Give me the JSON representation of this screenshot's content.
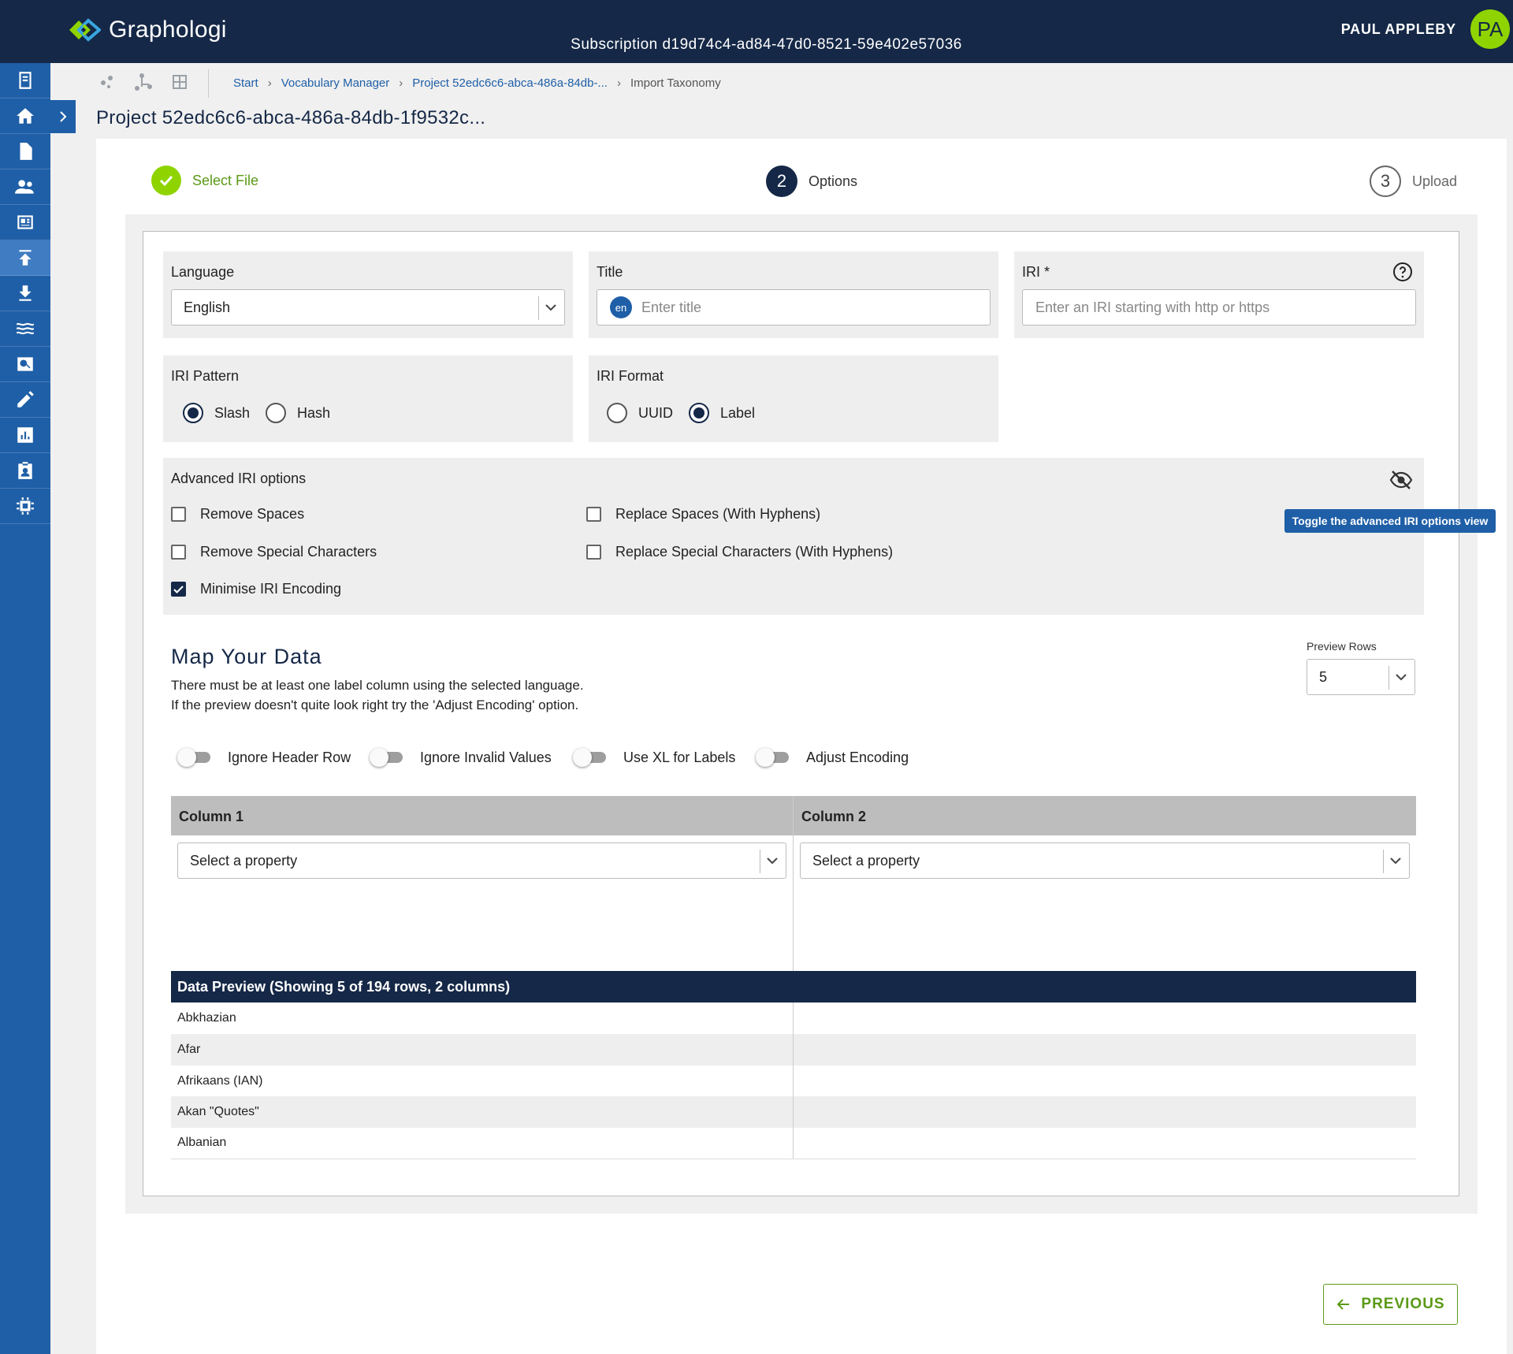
{
  "header": {
    "app_name": "Graphologi",
    "subscription": "Subscription d19d74c4-ad84-47d0-8521-59e402e57036",
    "user_name": "PAUL APPLEBY",
    "user_initials": "PA",
    "brand_color": "#152847",
    "accent_color": "#8fd400"
  },
  "sidebar": {
    "items": [
      {
        "icon": "notebook-icon"
      },
      {
        "icon": "home-icon"
      },
      {
        "icon": "document-icon"
      },
      {
        "icon": "users-icon"
      },
      {
        "icon": "article-icon"
      },
      {
        "icon": "upload-icon",
        "active": true
      },
      {
        "icon": "download-icon"
      },
      {
        "icon": "waves-icon"
      },
      {
        "icon": "search-image-icon"
      },
      {
        "icon": "pencil-icon"
      },
      {
        "icon": "bar-chart-icon"
      },
      {
        "icon": "badge-icon"
      },
      {
        "icon": "chip-icon"
      }
    ]
  },
  "breadcrumb": {
    "start": "Start",
    "vocab_manager": "Vocabulary Manager",
    "project": "Project 52edc6c6-abca-486a-84db-...",
    "current": "Import Taxonomy"
  },
  "page": {
    "title": "Project 52edc6c6-abca-486a-84db-1f9532c..."
  },
  "stepper": {
    "step1_label": "Select File",
    "step2_number": "2",
    "step2_label": "Options",
    "step3_number": "3",
    "step3_label": "Upload"
  },
  "options": {
    "language_label": "Language",
    "language_value": "English",
    "title_label": "Title",
    "title_lang_badge": "en",
    "title_placeholder": "Enter title",
    "iri_label": "IRI *",
    "iri_placeholder": "Enter an IRI starting with http or https",
    "iri_pattern_label": "IRI Pattern",
    "iri_pattern_options": [
      "Slash",
      "Hash"
    ],
    "iri_pattern_selected": "Slash",
    "iri_format_label": "IRI Format",
    "iri_format_options": [
      "UUID",
      "Label"
    ],
    "iri_format_selected": "Label"
  },
  "advanced": {
    "label": "Advanced IRI options",
    "tooltip": "Toggle the advanced IRI options view",
    "remove_spaces": "Remove Spaces",
    "replace_spaces": "Replace Spaces (With Hyphens)",
    "remove_special": "Remove Special Characters",
    "replace_special": "Replace Special Characters (With Hyphens)",
    "minimise_encoding": "Minimise IRI Encoding",
    "minimise_checked": true
  },
  "map": {
    "title": "Map Your Data",
    "desc_line1": "There must be at least one label column using the selected language.",
    "desc_line2": "If the preview doesn't quite look right try the 'Adjust Encoding' option.",
    "preview_rows_label": "Preview Rows",
    "preview_rows_value": "5",
    "toggles": [
      "Ignore Header Row",
      "Ignore Invalid Values",
      "Use XL for Labels",
      "Adjust Encoding"
    ],
    "column1": "Column 1",
    "column2": "Column 2",
    "select_placeholder": "Select a property",
    "preview_title": "Data Preview (Showing 5 of 194 rows, 2 columns)",
    "rows": [
      "Abkhazian",
      "Afar",
      "Afrikaans (IAN)",
      "Akan \"Quotes\"",
      "Albanian"
    ]
  },
  "footer": {
    "previous_label": "PREVIOUS"
  }
}
